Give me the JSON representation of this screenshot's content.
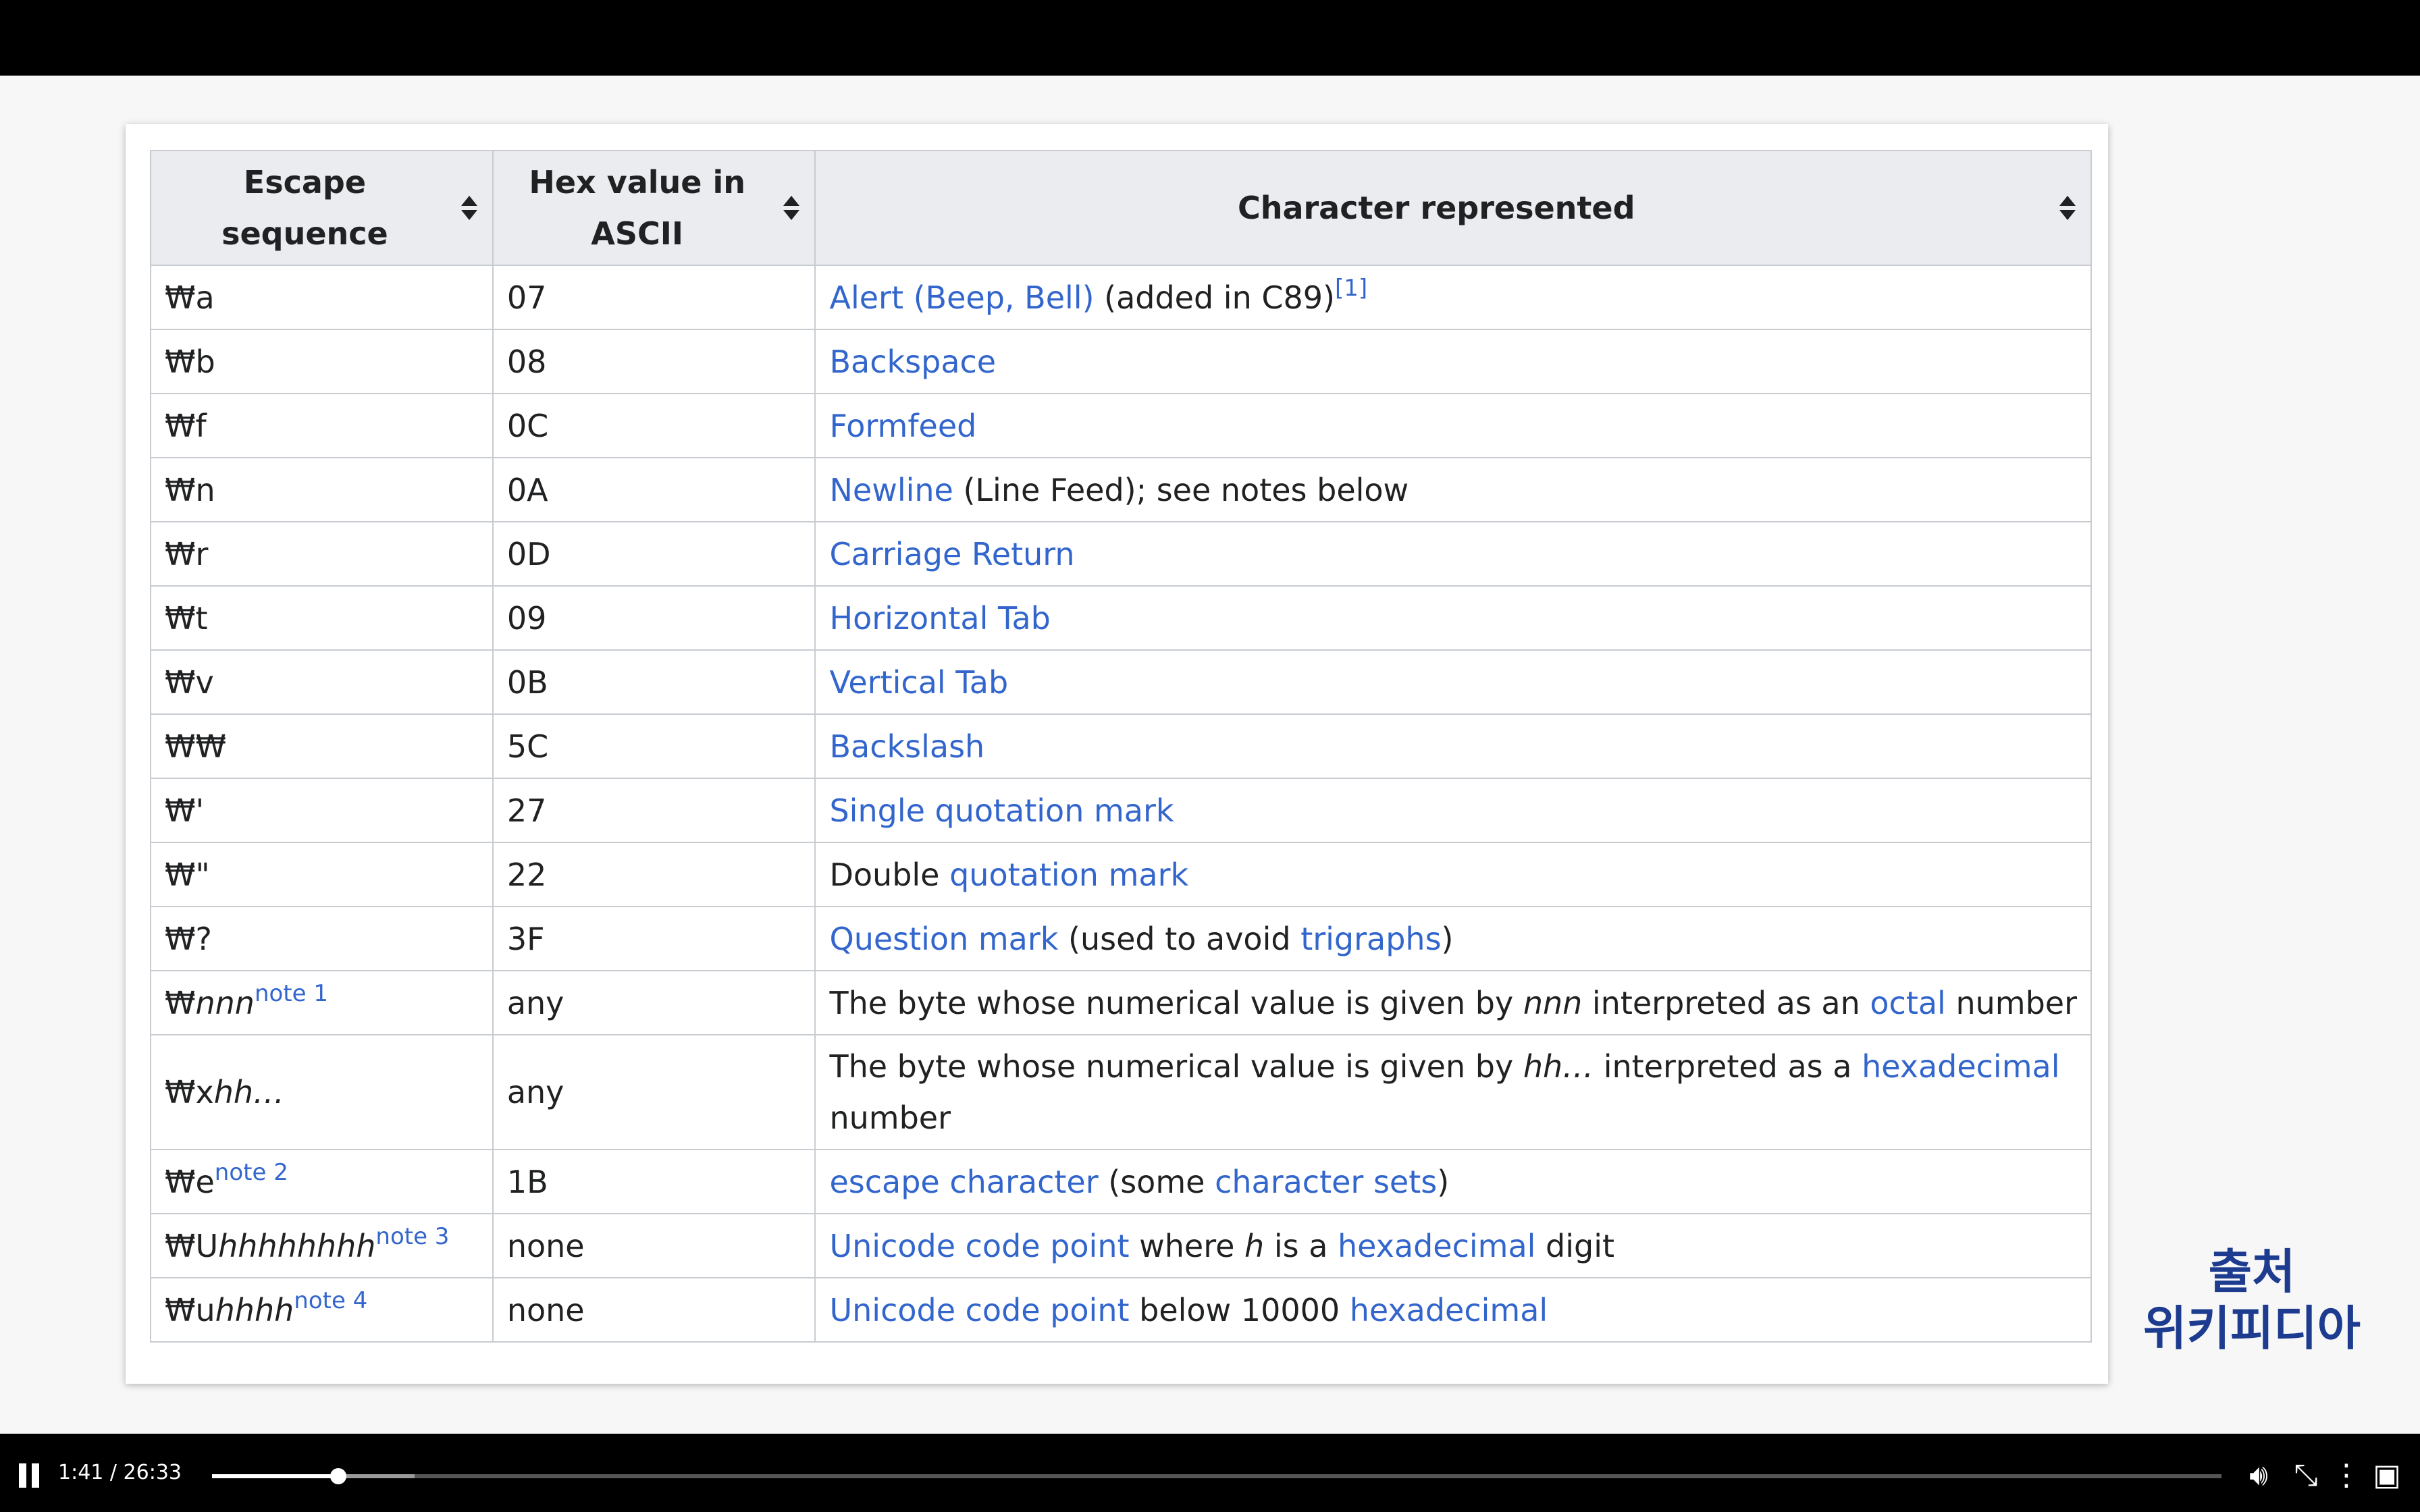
{
  "table": {
    "headers": [
      {
        "line1": "Escape",
        "line2": "sequence"
      },
      {
        "line1": "Hex value in",
        "line2": "ASCII"
      },
      {
        "line1": "Character represented",
        "line2": ""
      }
    ],
    "rows": [
      {
        "esc": "₩a",
        "hex": "07",
        "parts": [
          [
            "Alert (Beep, Bell)",
            "link"
          ],
          [
            " (added in C89)",
            "text"
          ],
          [
            "[1]",
            "sup"
          ]
        ]
      },
      {
        "esc": "₩b",
        "hex": "08",
        "parts": [
          [
            "Backspace",
            "link"
          ]
        ]
      },
      {
        "esc": "₩f",
        "hex": "0C",
        "parts": [
          [
            "Formfeed",
            "link"
          ]
        ]
      },
      {
        "esc": "₩n",
        "hex": "0A",
        "parts": [
          [
            "Newline",
            "link"
          ],
          [
            " (Line Feed); see notes below",
            "text"
          ]
        ]
      },
      {
        "esc": "₩r",
        "hex": "0D",
        "parts": [
          [
            "Carriage Return",
            "link"
          ]
        ]
      },
      {
        "esc": "₩t",
        "hex": "09",
        "parts": [
          [
            "Horizontal Tab",
            "link"
          ]
        ]
      },
      {
        "esc": "₩v",
        "hex": "0B",
        "parts": [
          [
            "Vertical Tab",
            "link"
          ]
        ]
      },
      {
        "esc": "₩₩",
        "hex": "5C",
        "parts": [
          [
            "Backslash",
            "link"
          ]
        ]
      },
      {
        "esc": "₩'",
        "hex": "27",
        "parts": [
          [
            "Single quotation mark",
            "link"
          ]
        ]
      },
      {
        "esc": "₩\"",
        "hex": "22",
        "parts": [
          [
            "Double ",
            "text"
          ],
          [
            "quotation mark",
            "link"
          ]
        ]
      },
      {
        "esc": "₩?",
        "hex": "3F",
        "parts": [
          [
            "Question mark",
            "link"
          ],
          [
            " (used to avoid ",
            "text"
          ],
          [
            "trigraphs",
            "link"
          ],
          [
            ")",
            "text"
          ]
        ]
      },
      {
        "esc": "₩",
        "esc_it": "nnn",
        "esc_sup": "note 1",
        "hex": "any",
        "parts": [
          [
            "The byte whose numerical value is given by ",
            "text"
          ],
          [
            "nnn",
            "italic"
          ],
          [
            " interpreted as an ",
            "text"
          ],
          [
            "octal",
            "link"
          ],
          [
            " number",
            "text"
          ]
        ]
      },
      {
        "esc": "₩x",
        "esc_it": "hh…",
        "hex": "any",
        "tall": true,
        "parts": [
          [
            "The byte whose numerical value is given by ",
            "text"
          ],
          [
            "hh…",
            "italic"
          ],
          [
            " interpreted as a ",
            "text"
          ],
          [
            "hexadecimal",
            "link"
          ],
          [
            " number",
            "text"
          ]
        ]
      },
      {
        "esc": "₩e",
        "esc_sup": "note 2",
        "hex": "1B",
        "parts": [
          [
            "escape character",
            "link"
          ],
          [
            " (some ",
            "text"
          ],
          [
            "character sets",
            "link"
          ],
          [
            ")",
            "text"
          ]
        ]
      },
      {
        "esc": "₩U",
        "esc_it": "hhhhhhhh",
        "esc_sup": "note 3",
        "hex": "none",
        "parts": [
          [
            "Unicode code point",
            "link"
          ],
          [
            " where ",
            "text"
          ],
          [
            "h",
            "italic"
          ],
          [
            " is a ",
            "text"
          ],
          [
            "hexadecimal",
            "link"
          ],
          [
            " digit",
            "text"
          ]
        ]
      },
      {
        "esc": "₩u",
        "esc_it": "hhhh",
        "esc_sup": "note 4",
        "hex": "none",
        "parts": [
          [
            "Unicode code point",
            "link"
          ],
          [
            " below 10000 ",
            "text"
          ],
          [
            "hexadecimal",
            "link"
          ]
        ]
      }
    ]
  },
  "source_label": {
    "line1": "출처",
    "line2": "위키피디아"
  },
  "player": {
    "time": "1:41 / 26:33",
    "progress_fraction": 0.063
  },
  "colors": {
    "link": "#3366cc",
    "header_bg": "#eaecf0",
    "border": "#c8ccd1",
    "source_text": "#1d3c8f"
  }
}
